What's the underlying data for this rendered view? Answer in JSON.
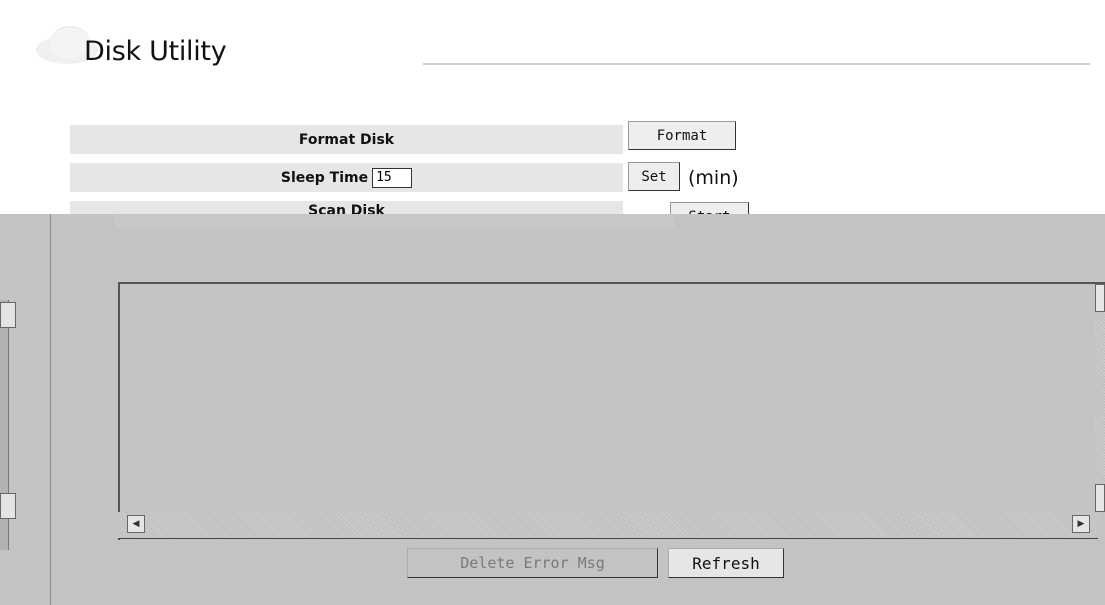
{
  "header": {
    "title": "Disk Utility"
  },
  "rows": {
    "format_disk": {
      "label": "Format Disk",
      "button": "Format"
    },
    "sleep_time": {
      "label": "Sleep Time",
      "value": "15",
      "button": "Set",
      "unit": "(min)"
    },
    "scan_disk": {
      "label": "Scan Disk",
      "button": "Start"
    }
  },
  "log": {
    "delete_button": "Delete Error Msg",
    "refresh_button": "Refresh"
  },
  "icons": {
    "logo": "cloud-icon",
    "scroll_left": "arrow-left-icon",
    "scroll_right": "arrow-right-icon"
  }
}
